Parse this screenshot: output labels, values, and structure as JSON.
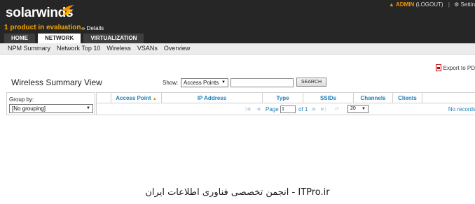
{
  "header": {
    "logo_text": "solarwinds",
    "evaluation_text": "1 product in evaluation.",
    "details_link": "» Details",
    "user_name": "ADMIN",
    "logout_label": "(LOGOUT)",
    "settings_label": "Settin",
    "accent_color": "#f39200"
  },
  "tabs": [
    {
      "label": "HOME"
    },
    {
      "label": "NETWORK",
      "active": true
    },
    {
      "label": "VIRTUALIZATION"
    }
  ],
  "subnav": [
    {
      "label": "NPM Summary"
    },
    {
      "label": "Network Top 10"
    },
    {
      "label": "Wireless"
    },
    {
      "label": "VSANs"
    },
    {
      "label": "Overview"
    }
  ],
  "export_label": "Export to PD",
  "view": {
    "title": "Wireless Summary View",
    "show_label": "Show:",
    "show_value": "Access Points",
    "search_value": "",
    "search_button": "SEARCH"
  },
  "group_by": {
    "label": "Group by:",
    "value": "[No grouping]"
  },
  "grid": {
    "columns": [
      "Access Point",
      "IP Address",
      "Type",
      "SSIDs",
      "Channels",
      "Clients"
    ],
    "page_label": "Page",
    "page_value": "1",
    "of_label": "of 1",
    "page_size": "20",
    "no_records": "No records"
  },
  "watermark": "ITPro.ir - انجمن تخصصی فناوری اطلاعات ایران"
}
